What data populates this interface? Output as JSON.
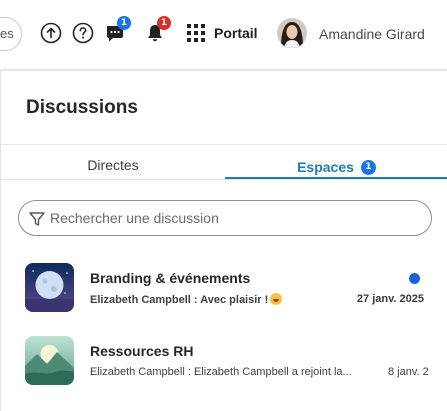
{
  "topbar": {
    "cut_button_text": "es",
    "upload_icon": "upload-circle-icon",
    "help_icon": "help-circle-icon",
    "chat_icon": "chat-bubble-icon",
    "chat_badge": "1",
    "bell_icon": "bell-icon",
    "bell_badge": "1",
    "portal_icon": "grid-icon",
    "portal_label": "Portail",
    "user_name": "Amandine Girard"
  },
  "panel": {
    "title": "Discussions",
    "tabs": [
      {
        "label": "Directes",
        "active": false
      },
      {
        "label": "Espaces",
        "active": true,
        "badge": "1"
      }
    ],
    "search": {
      "placeholder": "Rechercher une discussion",
      "value": ""
    },
    "items": [
      {
        "title": "Branding & événements",
        "subtitle": "Elizabeth Campbell : Avec plaisir !",
        "date": "27 janv. 2025",
        "unread": true,
        "emoji": "grinning-face-emoji"
      },
      {
        "title": "Ressources RH",
        "subtitle": "Elizabeth Campbell : Elizabeth Campbell a rejoint la...",
        "date": "8 janv. 2",
        "unread": false
      }
    ]
  },
  "colors": {
    "accent": "#1f7ab8",
    "badge_blue": "#1a73e8",
    "badge_red": "#d93025",
    "unread_dot": "#1a62d6"
  }
}
